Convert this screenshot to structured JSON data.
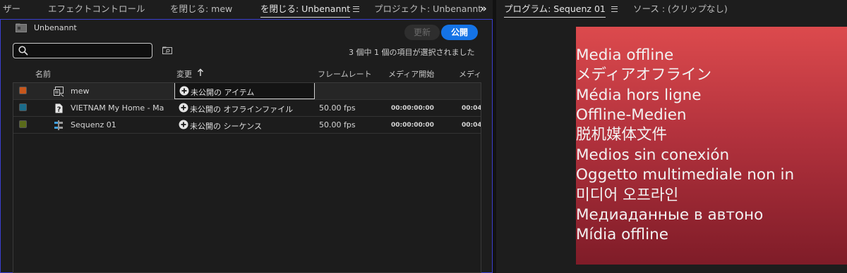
{
  "left_tabs": {
    "partial_first": "ザー",
    "effect_controls": "エフェクトコントロール",
    "close_mew": "を閉じる: mew",
    "close_unbenannt": "を閉じる: Unbenannt",
    "project": "プロジェクト: Unbenannt"
  },
  "right_tabs": {
    "program": "プログラム: Sequenz 01",
    "source": "ソース : (クリップなし)"
  },
  "project_panel": {
    "name": "Unbenannt",
    "update_label": "更新",
    "publish_label": "公開",
    "search_value": "",
    "selection_status": "3 個中 1 個の項目が選択されました"
  },
  "columns": {
    "name": "名前",
    "change": "変更",
    "frame_rate": "フレームレート",
    "media_start": "メディア開始",
    "media_end_partial": "メディ"
  },
  "rows": [
    {
      "label_color": "#c7561b",
      "icon": "clip-multicam-icon",
      "name": "mew",
      "change": "未公開の アイテム",
      "fps": "",
      "media_start": "",
      "media_end": ""
    },
    {
      "label_color": "#1a6b8a",
      "icon": "missing-file-icon",
      "name": "VIETNAM   My Home - Ma",
      "change": "未公開の オフラインファイル",
      "fps": "50.00 fps",
      "media_start": "00:00:00:00",
      "media_end": "00:04:"
    },
    {
      "label_color": "#5a6b1a",
      "icon": "sequence-icon",
      "name": "Sequenz 01",
      "change": "未公開の シーケンス",
      "fps": "50.00 fps",
      "media_start": "00:00:00:00",
      "media_end": "00:04:"
    }
  ],
  "monitor": {
    "background_top": "#dc4a4d",
    "background_bottom": "#7f1c28",
    "lines": [
      "Media offline",
      "メディアオフライン",
      "Média hors ligne",
      "Offline-Medien",
      "脱机媒体文件",
      "Medios sin conexión",
      "Oggetto multimediale non in",
      "미디어 오프라인",
      "Медиаданные в автоно",
      "Mídia offline"
    ]
  },
  "colors": {
    "accent_blue": "#1473e6",
    "panel_focus_border": "#3a3fd0"
  }
}
